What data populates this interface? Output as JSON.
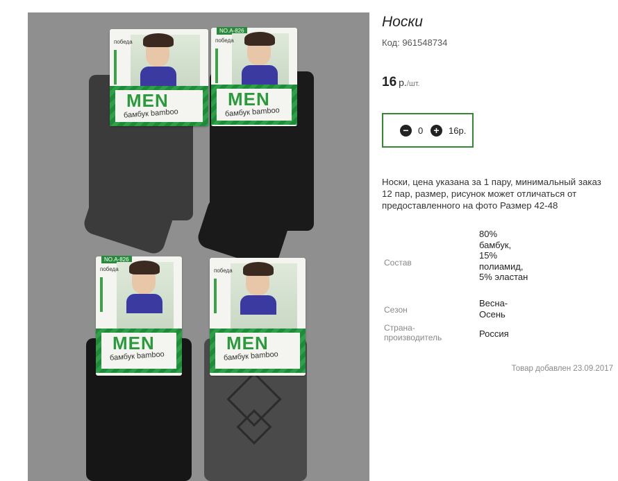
{
  "product": {
    "title": "Носки",
    "code_label": "Код: 961548734",
    "price_value": "16",
    "price_currency": "р.",
    "price_unit": "/шт.",
    "quantity": "0",
    "sum": "16р.",
    "description": "Носки, цена указана за 1 пару, минимальный заказ 12 пар, размер, рисунок может отличаться от предоставленного на фото Размер 42-48",
    "properties": [
      {
        "key": "Состав",
        "value": "80% бамбук, 15% полиамид, 5% эластан"
      },
      {
        "key": "Сезон",
        "value": "Весна-Осень"
      },
      {
        "key": "Страна-производитель",
        "value": "Россия"
      }
    ],
    "added": "Товар добавлен 23.09.2017"
  },
  "photo": {
    "labels": [
      {
        "code": "",
        "logo": "победа",
        "brand": "MEN",
        "sub": "бамбук bamboo"
      },
      {
        "code": "NO.A-826",
        "logo": "победа",
        "brand": "MEN",
        "sub": "бамбук bamboo"
      },
      {
        "code": "NO.A-826",
        "logo": "победа",
        "brand": "MEN",
        "sub": "бамбук bamboo"
      },
      {
        "code": "",
        "logo": "победа",
        "brand": "MEN",
        "sub": "бамбук bamboo"
      }
    ]
  },
  "icons": {
    "minus": "minus-circle-icon",
    "plus": "plus-circle-icon"
  },
  "colors": {
    "qty_border": "#2e8b2e",
    "photo_bg": "#8f8f8f"
  }
}
